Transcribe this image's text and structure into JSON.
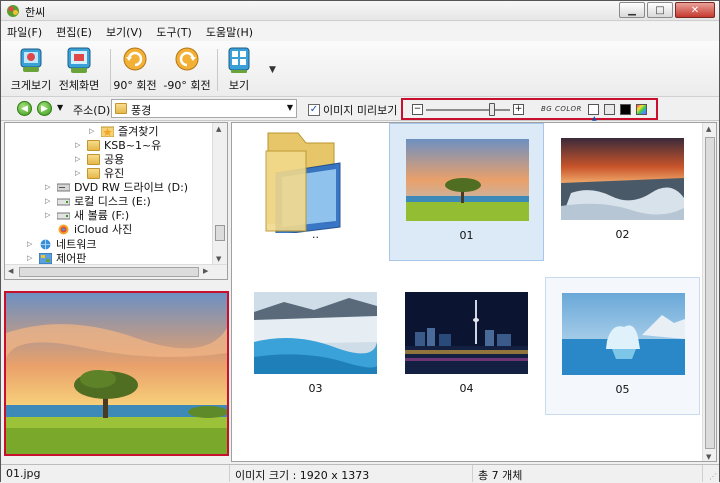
{
  "window": {
    "title": "한씨"
  },
  "menu": [
    {
      "label": "파일(F)"
    },
    {
      "label": "편집(E)"
    },
    {
      "label": "보기(V)"
    },
    {
      "label": "도구(T)"
    },
    {
      "label": "도움말(H)"
    }
  ],
  "toolbar": {
    "items": [
      {
        "label": "크게보기",
        "icon": "zoom-view-icon"
      },
      {
        "label": "전체화면",
        "icon": "fullscreen-icon"
      },
      {
        "label": "90° 회전",
        "icon": "rotate-cw-icon"
      },
      {
        "label": "-90° 회전",
        "icon": "rotate-ccw-icon"
      },
      {
        "label": "보기",
        "icon": "view-icon"
      }
    ],
    "more_glyph": "▼"
  },
  "address": {
    "label": "주소(D)",
    "value": "풍경",
    "preview_checkbox_label": "이미지 미리보기",
    "preview_checked": true,
    "zoom_level_fraction": 0.78,
    "bg_color_label": "BG COLOR",
    "bg_swatches": [
      "#ffffff",
      "#e8e8e8",
      "#000000",
      "multicolor"
    ]
  },
  "tree": [
    {
      "label": "즐겨찾기",
      "icon": "star-folder-icon",
      "indent": 5
    },
    {
      "label": "KSB~1~유",
      "icon": "folder-icon",
      "indent": 4
    },
    {
      "label": "공용",
      "icon": "folder-icon",
      "indent": 4
    },
    {
      "label": "유진",
      "icon": "folder-icon",
      "indent": 4
    },
    {
      "label": "DVD RW 드라이브 (D:)",
      "icon": "dvd-drive-icon",
      "indent": 2
    },
    {
      "label": "로컬 디스크 (E:)",
      "icon": "disk-icon",
      "indent": 2
    },
    {
      "label": "새 볼륨 (F:)",
      "icon": "disk-icon",
      "indent": 2
    },
    {
      "label": "iCloud 사진",
      "icon": "icloud-photos-icon",
      "indent": 2
    },
    {
      "label": "네트워크",
      "icon": "network-icon",
      "indent": 1
    },
    {
      "label": "제어판",
      "icon": "control-panel-icon",
      "indent": 1
    }
  ],
  "thumbnails": [
    {
      "label": "..",
      "kind": "parent-folder"
    },
    {
      "label": "01",
      "kind": "image",
      "scene": "sunset-tree",
      "state": "selected"
    },
    {
      "label": "02",
      "kind": "image",
      "scene": "ice-sunset"
    },
    {
      "label": "03",
      "kind": "image",
      "scene": "glacier"
    },
    {
      "label": "04",
      "kind": "image",
      "scene": "city-night"
    },
    {
      "label": "05",
      "kind": "image",
      "scene": "iceberg",
      "state": "hover"
    }
  ],
  "status": {
    "filename": "01.jpg",
    "image_size": "이미지 크기 : 1920 x 1373",
    "count": "총 7 개체"
  }
}
